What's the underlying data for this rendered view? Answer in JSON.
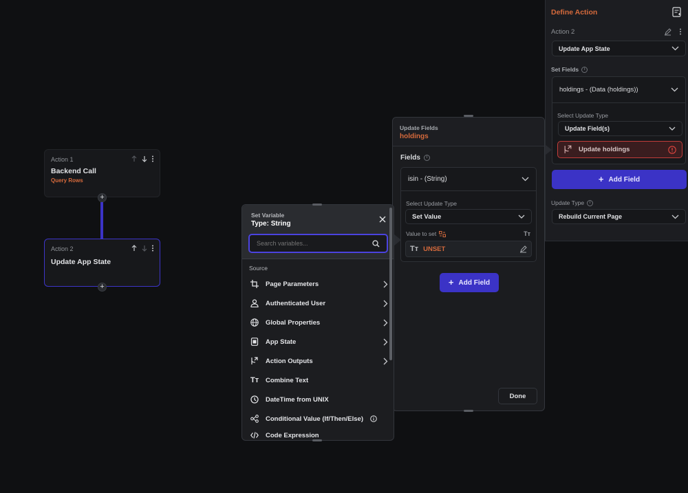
{
  "canvas": {
    "action1": {
      "kicker": "Action 1",
      "title": "Backend Call",
      "subtitle": "Query Rows"
    },
    "action2": {
      "kicker": "Action 2",
      "title": "Update App State"
    },
    "plus": "+"
  },
  "set_variable": {
    "title": "Set Variable",
    "type": "Type: String",
    "search_placeholder": "Search variables...",
    "source_label": "Source",
    "items": [
      {
        "label": "Page Parameters",
        "icon": "crop-icon",
        "has_chevron": true
      },
      {
        "label": "Authenticated User",
        "icon": "user-icon",
        "has_chevron": true
      },
      {
        "label": "Global Properties",
        "icon": "globe-icon",
        "has_chevron": true
      },
      {
        "label": "App State",
        "icon": "app-state-icon",
        "has_chevron": true
      },
      {
        "label": "Action Outputs",
        "icon": "action-outputs-icon",
        "has_chevron": true
      },
      {
        "label": "Combine Text",
        "icon": "text-format-icon",
        "has_chevron": false
      },
      {
        "label": "DateTime from UNIX",
        "icon": "clock-icon",
        "has_chevron": false
      },
      {
        "label": "Conditional Value (If/Then/Else)",
        "icon": "conditional-icon",
        "has_chevron": false
      },
      {
        "label": "Code Expression",
        "icon": "code-icon",
        "has_chevron": false
      }
    ]
  },
  "update_fields": {
    "header_label": "Update Fields",
    "header_value": "holdings",
    "fields_label": "Fields",
    "field_select": "isin - (String)",
    "select_update_type_label": "Select Update Type",
    "update_type_value": "Set Value",
    "value_to_set_label": "Value to set",
    "value_text": "UNSET",
    "add_field_label": "Add Field",
    "done_label": "Done"
  },
  "define_action": {
    "title": "Define Action",
    "action_label": "Action 2",
    "action_type": "Update App State",
    "set_fields_label": "Set Fields",
    "field_select": "holdings - (Data (holdings))",
    "select_update_type_label": "Select Update Type",
    "update_type_value": "Update Field(s)",
    "update_holdings_label": "Update holdings",
    "add_field_label": "Add Field",
    "update_type_label": "Update Type",
    "update_type_select": "Rebuild Current Page"
  },
  "colors": {
    "accent": "#3b33c6",
    "orange": "#d66a3c",
    "error": "#e0453f",
    "bg": "#0f1012"
  }
}
